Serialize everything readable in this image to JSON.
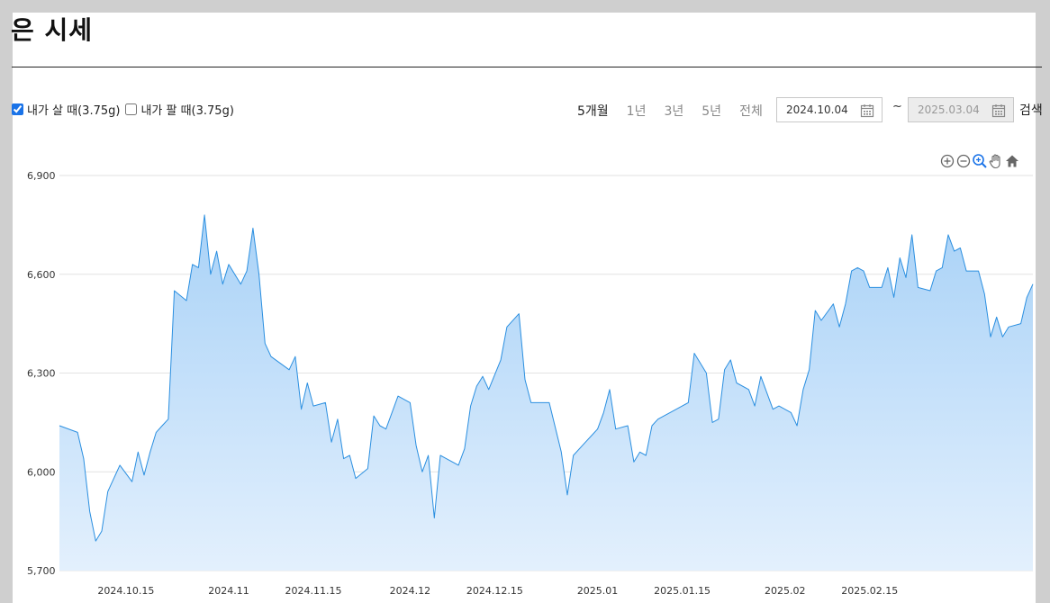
{
  "page": {
    "title": "은 시세"
  },
  "options": {
    "buy_label": "내가 살 때(3.75g)",
    "sell_label": "내가 팔 때(3.75g)"
  },
  "periods": [
    "5개월",
    "1년",
    "3년",
    "5년",
    "전체"
  ],
  "date_range": {
    "from": "2024.10.04",
    "separator": "~",
    "to": "2025.03.04"
  },
  "search_label": "검색",
  "colors": {
    "line": "#2b8fe0",
    "fill_top": "#a9d2f7",
    "fill_bottom": "#e3f0fd",
    "grid": "#e2e2e2"
  },
  "chart_data": {
    "type": "area",
    "ylim": [
      5700,
      6900
    ],
    "yticks": [
      "5,700",
      "6,000",
      "6,300",
      "6,600",
      "6,900"
    ],
    "xticks": [
      {
        "label": "2024.10.15",
        "date": "2024-10-15"
      },
      {
        "label": "2024.11",
        "date": "2024-11-01"
      },
      {
        "label": "2024.11.15",
        "date": "2024-11-15"
      },
      {
        "label": "2024.12",
        "date": "2024-12-01"
      },
      {
        "label": "2024.12.15",
        "date": "2024-12-15"
      },
      {
        "label": "2025.01",
        "date": "2025-01-01"
      },
      {
        "label": "2025.01.15",
        "date": "2025-01-15"
      },
      {
        "label": "2025.02",
        "date": "2025-02-01"
      },
      {
        "label": "2025.02.15",
        "date": "2025-02-15"
      }
    ],
    "x_range": [
      "2024-10-04",
      "2025-03-04"
    ],
    "points": [
      [
        "2024-10-04",
        6140
      ],
      [
        "2024-10-07",
        6120
      ],
      [
        "2024-10-08",
        6040
      ],
      [
        "2024-10-09",
        5880
      ],
      [
        "2024-10-10",
        5790
      ],
      [
        "2024-10-11",
        5820
      ],
      [
        "2024-10-12",
        5940
      ],
      [
        "2024-10-14",
        6020
      ],
      [
        "2024-10-16",
        5970
      ],
      [
        "2024-10-17",
        6060
      ],
      [
        "2024-10-18",
        5990
      ],
      [
        "2024-10-19",
        6060
      ],
      [
        "2024-10-20",
        6120
      ],
      [
        "2024-10-21",
        6140
      ],
      [
        "2024-10-22",
        6160
      ],
      [
        "2024-10-23",
        6550
      ],
      [
        "2024-10-25",
        6520
      ],
      [
        "2024-10-26",
        6630
      ],
      [
        "2024-10-27",
        6620
      ],
      [
        "2024-10-28",
        6780
      ],
      [
        "2024-10-29",
        6600
      ],
      [
        "2024-10-30",
        6670
      ],
      [
        "2024-10-31",
        6570
      ],
      [
        "2024-11-01",
        6630
      ],
      [
        "2024-11-03",
        6570
      ],
      [
        "2024-11-04",
        6610
      ],
      [
        "2024-11-05",
        6740
      ],
      [
        "2024-11-06",
        6600
      ],
      [
        "2024-11-07",
        6390
      ],
      [
        "2024-11-08",
        6350
      ],
      [
        "2024-11-11",
        6310
      ],
      [
        "2024-11-12",
        6350
      ],
      [
        "2024-11-13",
        6190
      ],
      [
        "2024-11-14",
        6270
      ],
      [
        "2024-11-15",
        6200
      ],
      [
        "2024-11-17",
        6210
      ],
      [
        "2024-11-18",
        6090
      ],
      [
        "2024-11-19",
        6160
      ],
      [
        "2024-11-20",
        6040
      ],
      [
        "2024-11-21",
        6050
      ],
      [
        "2024-11-22",
        5980
      ],
      [
        "2024-11-24",
        6010
      ],
      [
        "2024-11-25",
        6170
      ],
      [
        "2024-11-26",
        6140
      ],
      [
        "2024-11-27",
        6130
      ],
      [
        "2024-11-28",
        6180
      ],
      [
        "2024-11-29",
        6230
      ],
      [
        "2024-12-01",
        6210
      ],
      [
        "2024-12-02",
        6080
      ],
      [
        "2024-12-03",
        6000
      ],
      [
        "2024-12-04",
        6050
      ],
      [
        "2024-12-05",
        5860
      ],
      [
        "2024-12-06",
        6050
      ],
      [
        "2024-12-09",
        6020
      ],
      [
        "2024-12-10",
        6070
      ],
      [
        "2024-12-11",
        6200
      ],
      [
        "2024-12-12",
        6260
      ],
      [
        "2024-12-13",
        6290
      ],
      [
        "2024-12-14",
        6250
      ],
      [
        "2024-12-16",
        6340
      ],
      [
        "2024-12-17",
        6440
      ],
      [
        "2024-12-19",
        6480
      ],
      [
        "2024-12-20",
        6280
      ],
      [
        "2024-12-21",
        6210
      ],
      [
        "2024-12-24",
        6210
      ],
      [
        "2024-12-26",
        6060
      ],
      [
        "2024-12-27",
        5930
      ],
      [
        "2024-12-28",
        6050
      ],
      [
        "2024-12-30",
        6090
      ],
      [
        "2024-12-31",
        6110
      ],
      [
        "2025-01-01",
        6130
      ],
      [
        "2025-01-02",
        6180
      ],
      [
        "2025-01-03",
        6250
      ],
      [
        "2025-01-04",
        6130
      ],
      [
        "2025-01-06",
        6140
      ],
      [
        "2025-01-07",
        6030
      ],
      [
        "2025-01-08",
        6060
      ],
      [
        "2025-01-09",
        6050
      ],
      [
        "2025-01-10",
        6140
      ],
      [
        "2025-01-11",
        6160
      ],
      [
        "2025-01-13",
        6180
      ],
      [
        "2025-01-15",
        6200
      ],
      [
        "2025-01-16",
        6210
      ],
      [
        "2025-01-17",
        6360
      ],
      [
        "2025-01-19",
        6300
      ],
      [
        "2025-01-20",
        6150
      ],
      [
        "2025-01-21",
        6160
      ],
      [
        "2025-01-22",
        6310
      ],
      [
        "2025-01-23",
        6340
      ],
      [
        "2025-01-24",
        6270
      ],
      [
        "2025-01-26",
        6250
      ],
      [
        "2025-01-27",
        6200
      ],
      [
        "2025-01-28",
        6290
      ],
      [
        "2025-01-29",
        6240
      ],
      [
        "2025-01-30",
        6190
      ],
      [
        "2025-01-31",
        6200
      ],
      [
        "2025-02-02",
        6180
      ],
      [
        "2025-02-03",
        6140
      ],
      [
        "2025-02-04",
        6250
      ],
      [
        "2025-02-05",
        6310
      ],
      [
        "2025-02-06",
        6490
      ],
      [
        "2025-02-07",
        6460
      ],
      [
        "2025-02-09",
        6510
      ],
      [
        "2025-02-10",
        6440
      ],
      [
        "2025-02-11",
        6510
      ],
      [
        "2025-02-12",
        6610
      ],
      [
        "2025-02-13",
        6620
      ],
      [
        "2025-02-14",
        6610
      ],
      [
        "2025-02-15",
        6560
      ],
      [
        "2025-02-17",
        6560
      ],
      [
        "2025-02-18",
        6620
      ],
      [
        "2025-02-19",
        6530
      ],
      [
        "2025-02-20",
        6650
      ],
      [
        "2025-02-21",
        6590
      ],
      [
        "2025-02-22",
        6720
      ],
      [
        "2025-02-23",
        6560
      ],
      [
        "2025-02-25",
        6550
      ],
      [
        "2025-02-26",
        6610
      ],
      [
        "2025-02-27",
        6620
      ],
      [
        "2025-02-28",
        6720
      ],
      [
        "2025-03-01",
        6670
      ],
      [
        "2025-03-02",
        6680
      ],
      [
        "2025-03-03",
        6610
      ],
      [
        "2025-03-04",
        6610
      ],
      [
        "2025-03-05",
        6610
      ],
      [
        "2025-03-06",
        6540
      ],
      [
        "2025-03-07",
        6410
      ],
      [
        "2025-03-08",
        6470
      ],
      [
        "2025-03-09",
        6410
      ],
      [
        "2025-03-10",
        6440
      ],
      [
        "2025-03-12",
        6450
      ],
      [
        "2025-03-13",
        6530
      ],
      [
        "2025-03-14",
        6570
      ]
    ]
  }
}
